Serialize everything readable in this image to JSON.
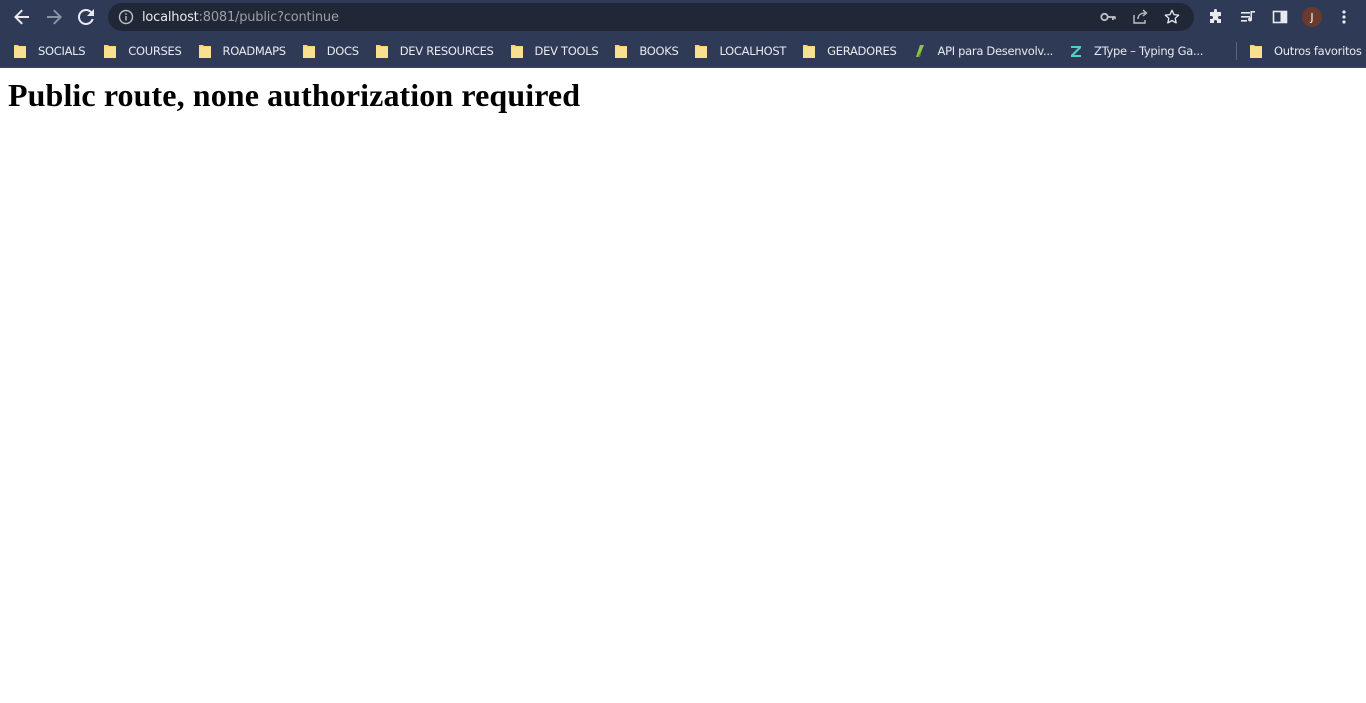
{
  "browser": {
    "url_host": "localhost",
    "url_rest": ":8081/public?continue",
    "profile_initial": "J"
  },
  "bookmarks": [
    {
      "label": "SOCIALS",
      "icon": "folder-icon"
    },
    {
      "label": "COURSES",
      "icon": "folder-icon"
    },
    {
      "label": "ROADMAPS",
      "icon": "folder-icon"
    },
    {
      "label": "DOCS",
      "icon": "folder-icon"
    },
    {
      "label": "DEV RESOURCES",
      "icon": "folder-icon"
    },
    {
      "label": "DEV TOOLS",
      "icon": "folder-icon"
    },
    {
      "label": "BOOKS",
      "icon": "folder-icon"
    },
    {
      "label": "LOCALHOST",
      "icon": "folder-icon"
    },
    {
      "label": "GERADORES",
      "icon": "folder-icon"
    },
    {
      "label": "API para Desenvolv...",
      "icon": "api-site-icon"
    },
    {
      "label": "ZType – Typing Ga...",
      "icon": "ztype-icon"
    }
  ],
  "other_bookmarks": {
    "label": "Outros favoritos"
  },
  "page": {
    "heading": "Public route, none authorization required"
  },
  "colors": {
    "chrome_bg": "#2f3a56",
    "omnibox_bg": "#202737",
    "folder": "#f6d774"
  }
}
